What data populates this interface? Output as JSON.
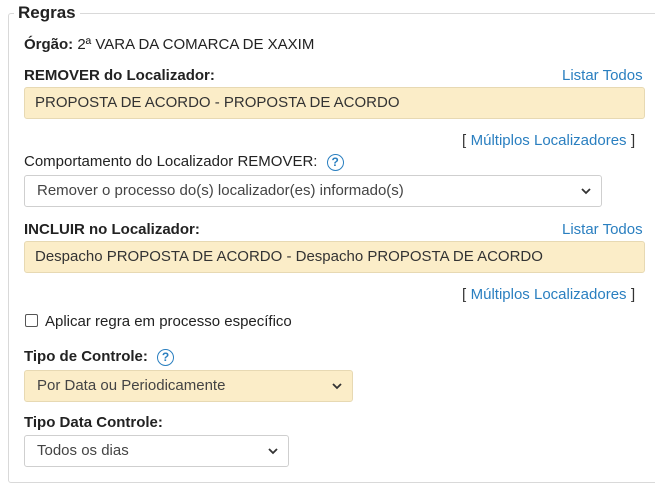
{
  "section": {
    "title": "Regras"
  },
  "orgao": {
    "label": "Órgão:",
    "value": "2ª VARA DA COMARCA DE XAXIM"
  },
  "remover": {
    "label": "REMOVER do Localizador:",
    "list_all": "Listar Todos",
    "value": "PROPOSTA DE ACORDO - PROPOSTA DE ACORDO",
    "multi_open": "[",
    "multi_link": "Múltiplos Localizadores",
    "multi_close": "]"
  },
  "comportamento": {
    "label": "Comportamento do Localizador REMOVER:",
    "help_icon": "?",
    "selected": "Remover o processo do(s) localizador(es) informado(s)"
  },
  "incluir": {
    "label": "INCLUIR no Localizador:",
    "list_all": "Listar Todos",
    "value": "Despacho PROPOSTA DE ACORDO - Despacho PROPOSTA DE ACORDO",
    "multi_open": "[",
    "multi_link": "Múltiplos Localizadores",
    "multi_close": "]"
  },
  "aplicar": {
    "label": "Aplicar regra em processo específico",
    "checked": false
  },
  "tipo_controle": {
    "label": "Tipo de Controle:",
    "help_icon": "?",
    "selected": "Por Data ou Periodicamente"
  },
  "tipo_data": {
    "label": "Tipo Data Controle:",
    "selected": "Todos os dias"
  },
  "colors": {
    "accent": "#2a7fc0",
    "highlight": "#fbedc8"
  }
}
